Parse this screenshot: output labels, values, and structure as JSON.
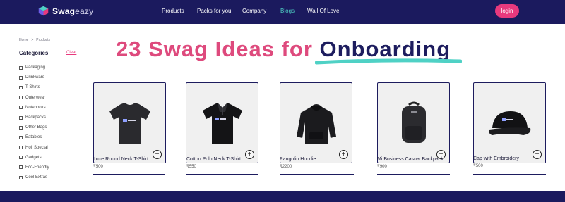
{
  "header": {
    "brand_bold": "Swag",
    "brand_light": "eazy",
    "nav": [
      "Products",
      "Packs for you",
      "Company",
      "Blogs",
      "Wall Of Love"
    ],
    "active_nav": "Blogs",
    "login_label": "login"
  },
  "breadcrumb": {
    "home": "Home",
    "separator": ">",
    "current": "Products"
  },
  "filters": {
    "title": "Categories",
    "clear_label": "Clear",
    "items": [
      "Packaging",
      "Drinkware",
      "T-Shirts",
      "Outerwear",
      "Notebooks",
      "Backpacks",
      "Other Bags",
      "Eatables",
      "Holi Special",
      "Gadgets",
      "Eco-Friendly",
      "Cool Extras"
    ]
  },
  "headline": {
    "prefix": "23 Swag Ideas for",
    "highlight": "Onboarding"
  },
  "products": [
    {
      "name": "Luxe Round Neck T-Shirt",
      "price": "₹500",
      "icon": "tshirt-icon"
    },
    {
      "name": "Cotton Polo Neck T-Shirt",
      "price": "₹550",
      "icon": "polo-shirt-icon"
    },
    {
      "name": "Pangolin Hoodie",
      "price": "₹2200",
      "icon": "hoodie-icon"
    },
    {
      "name": "Mi Business Casual Backpack",
      "price": "₹900",
      "icon": "backpack-icon"
    },
    {
      "name": "Cap with Embroidery",
      "price": "₹500",
      "icon": "cap-icon"
    }
  ],
  "colors": {
    "navy": "#1b1a5e",
    "pink": "#e8397d",
    "teal": "#4fd1c5",
    "headline_pink": "#de4a7d"
  }
}
